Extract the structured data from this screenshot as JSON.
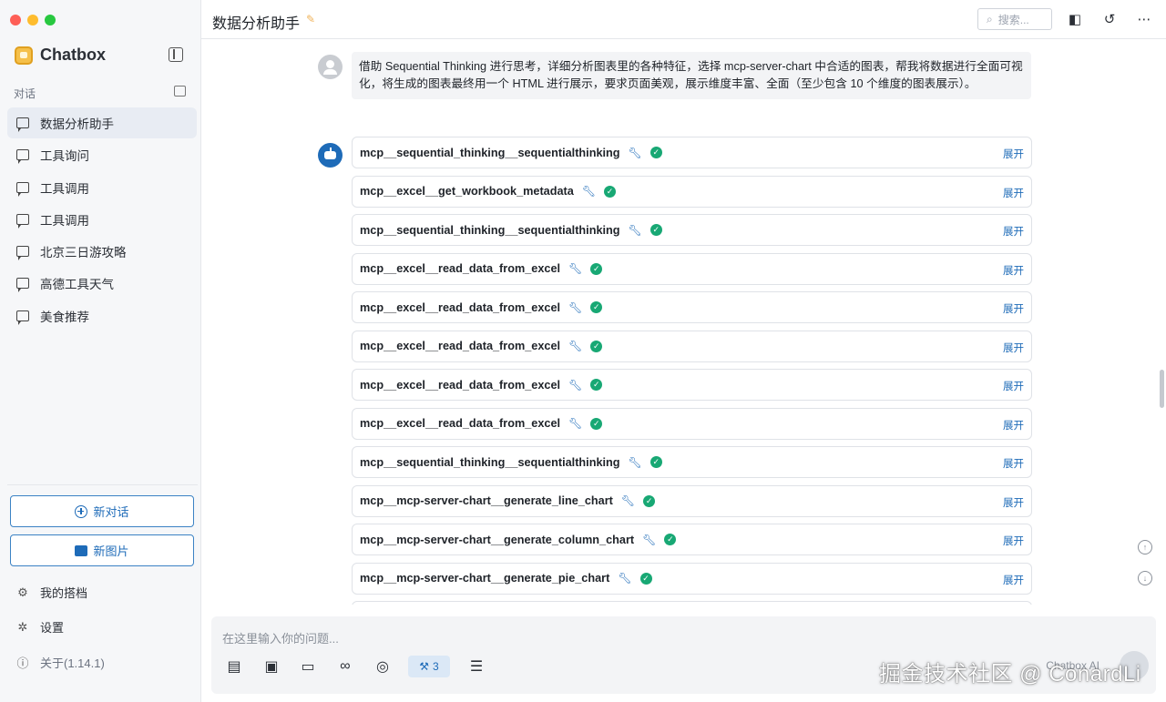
{
  "window": {
    "traffic_lights": [
      "#fe5f57",
      "#febc2e",
      "#28c840"
    ]
  },
  "sidebar": {
    "brand": "Chatbox",
    "section_label": "对话",
    "conversations": [
      {
        "label": "数据分析助手",
        "active": true
      },
      {
        "label": "工具询问",
        "active": false
      },
      {
        "label": "工具调用",
        "active": false
      },
      {
        "label": "工具调用",
        "active": false
      },
      {
        "label": "北京三日游攻略",
        "active": false
      },
      {
        "label": "高德工具天气",
        "active": false
      },
      {
        "label": "美食推荐",
        "active": false
      }
    ],
    "new_chat_label": "新对话",
    "new_image_label": "新图片",
    "my_partners_label": "我的搭档",
    "settings_label": "设置",
    "about_label": "关于(1.14.1)"
  },
  "header": {
    "title": "数据分析助手",
    "search_placeholder": "搜索..."
  },
  "user_message": {
    "text": "借助 Sequential Thinking 进行思考，详细分析图表里的各种特征，选择 mcp-server-chart 中合适的图表，帮我将数据进行全面可视化，将生成的图表最终用一个 HTML 进行展示，要求页面美观，展示维度丰富、全面（至少包含 10 个维度的图表展示）。"
  },
  "tool_calls": {
    "expand_label": "展开",
    "items": [
      {
        "name": "mcp__sequential_thinking__sequentialthinking"
      },
      {
        "name": "mcp__excel__get_workbook_metadata"
      },
      {
        "name": "mcp__sequential_thinking__sequentialthinking"
      },
      {
        "name": "mcp__excel__read_data_from_excel"
      },
      {
        "name": "mcp__excel__read_data_from_excel"
      },
      {
        "name": "mcp__excel__read_data_from_excel"
      },
      {
        "name": "mcp__excel__read_data_from_excel"
      },
      {
        "name": "mcp__excel__read_data_from_excel"
      },
      {
        "name": "mcp__sequential_thinking__sequentialthinking"
      },
      {
        "name": "mcp__mcp-server-chart__generate_line_chart"
      },
      {
        "name": "mcp__mcp-server-chart__generate_column_chart"
      },
      {
        "name": "mcp__mcp-server-chart__generate_pie_chart"
      },
      {
        "name": ""
      }
    ]
  },
  "input": {
    "placeholder": "在这里输入你的问题...",
    "tools_count": "3",
    "model_label": "Chatbox AI"
  },
  "watermark": "掘金技术社区 @ ConardLi",
  "colors": {
    "accent": "#1e6bb8",
    "success": "#18a874",
    "sidebar_bg": "#f6f7f9"
  }
}
